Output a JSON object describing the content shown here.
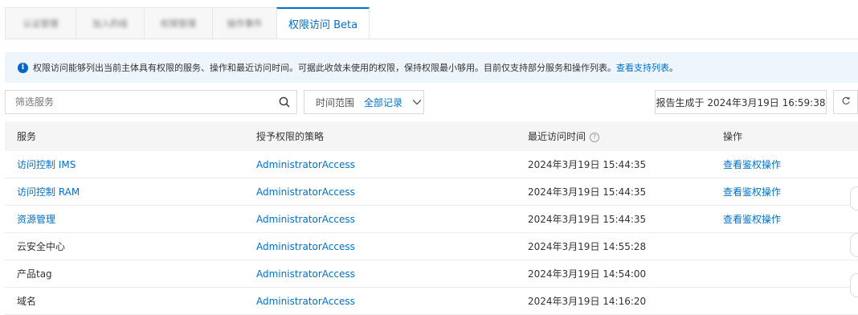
{
  "tabs": [
    {
      "label": "认证管理",
      "width": 88
    },
    {
      "label": "加入的组",
      "width": 85
    },
    {
      "label": "权限管理",
      "width": 85
    },
    {
      "label": "操作事件",
      "width": 80
    },
    {
      "label": "权限访问 Beta",
      "width": 116
    }
  ],
  "alert": {
    "text": "权限访问能够列出当前主体具有权限的服务、操作和最近访问时间。可据此收敛未使用的权限，保持权限最小够用。目前仅支持部分服务和操作列表。",
    "link": "查看支持列表",
    "tail": "。"
  },
  "search": {
    "placeholder": "筛选服务"
  },
  "range": {
    "label": "时间范围",
    "value": "全部记录"
  },
  "report": {
    "label": "报告生成于 2024年3月19日 16:59:38"
  },
  "table": {
    "headers": {
      "service": "服务",
      "policy": "授予权限的策略",
      "last_access": "最近访问时间",
      "action": "操作"
    },
    "rows": [
      {
        "service": "访问控制 IMS",
        "policy": "AdministratorAccess",
        "time": "2024年3月19日 15:44:35",
        "action": "查看鉴权操作"
      },
      {
        "service": "访问控制 RAM",
        "policy": "AdministratorAccess",
        "time": "2024年3月19日 15:44:35",
        "action": "查看鉴权操作"
      },
      {
        "service": "资源管理",
        "policy": "AdministratorAccess",
        "time": "2024年3月19日 15:44:35",
        "action": "查看鉴权操作"
      },
      {
        "service": "云安全中心",
        "policy": "AdministratorAccess",
        "time": "2024年3月19日 14:55:28",
        "action": ""
      },
      {
        "service": "产品tag",
        "policy": "AdministratorAccess",
        "time": "2024年3月19日 14:54:00",
        "action": ""
      },
      {
        "service": "域名",
        "policy": "AdministratorAccess",
        "time": "2024年3月19日 14:16:20",
        "action": ""
      }
    ]
  },
  "colors": {
    "accent": "#0070cc",
    "alert_bg": "#eef5fc",
    "header_bg": "#f5f5f5"
  }
}
